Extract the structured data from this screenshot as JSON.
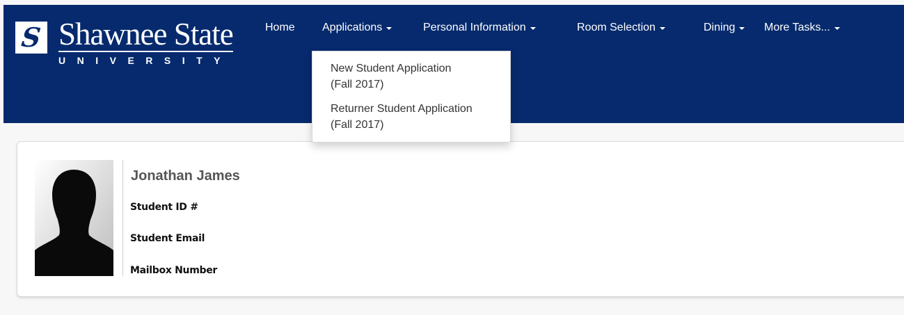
{
  "brand": {
    "mark": "S",
    "name": "Shawnee State",
    "subtitle": "UNIVERSITY"
  },
  "nav": {
    "home": "Home",
    "applications": "Applications",
    "personal_information": "Personal Information",
    "room_selection": "Room Selection",
    "dining": "Dining",
    "more_tasks": "More Tasks..."
  },
  "applications_menu": {
    "items": [
      {
        "label": "New Student Application",
        "term": "(Fall 2017)"
      },
      {
        "label": "Returner Student Application",
        "term": "(Fall 2017)"
      }
    ]
  },
  "profile": {
    "name": "Jonathan James",
    "student_id_label": "Student ID #",
    "student_email_label": "Student Email",
    "mailbox_label": "Mailbox Number"
  },
  "colors": {
    "navbar": "#062a6d",
    "page_background": "#f7f7f7"
  },
  "icons": {
    "logo": "shawnee-state-logo-mark",
    "avatar": "person-silhouette",
    "dropdown": "caret-down-icon"
  }
}
